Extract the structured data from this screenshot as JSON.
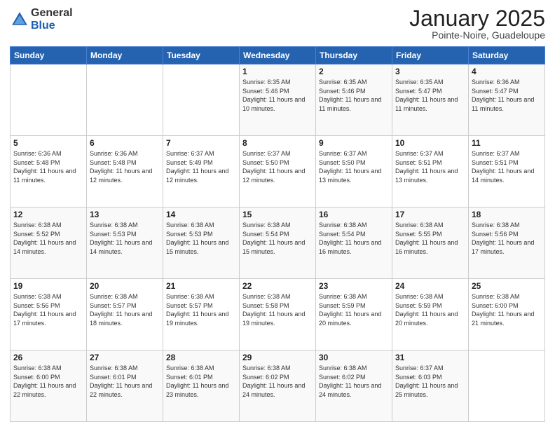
{
  "header": {
    "logo_general": "General",
    "logo_blue": "Blue",
    "month_title": "January 2025",
    "subtitle": "Pointe-Noire, Guadeloupe"
  },
  "weekdays": [
    "Sunday",
    "Monday",
    "Tuesday",
    "Wednesday",
    "Thursday",
    "Friday",
    "Saturday"
  ],
  "weeks": [
    [
      {
        "day": "",
        "sunrise": "",
        "sunset": "",
        "daylight": ""
      },
      {
        "day": "",
        "sunrise": "",
        "sunset": "",
        "daylight": ""
      },
      {
        "day": "",
        "sunrise": "",
        "sunset": "",
        "daylight": ""
      },
      {
        "day": "1",
        "sunrise": "Sunrise: 6:35 AM",
        "sunset": "Sunset: 5:46 PM",
        "daylight": "Daylight: 11 hours and 10 minutes."
      },
      {
        "day": "2",
        "sunrise": "Sunrise: 6:35 AM",
        "sunset": "Sunset: 5:46 PM",
        "daylight": "Daylight: 11 hours and 11 minutes."
      },
      {
        "day": "3",
        "sunrise": "Sunrise: 6:35 AM",
        "sunset": "Sunset: 5:47 PM",
        "daylight": "Daylight: 11 hours and 11 minutes."
      },
      {
        "day": "4",
        "sunrise": "Sunrise: 6:36 AM",
        "sunset": "Sunset: 5:47 PM",
        "daylight": "Daylight: 11 hours and 11 minutes."
      }
    ],
    [
      {
        "day": "5",
        "sunrise": "Sunrise: 6:36 AM",
        "sunset": "Sunset: 5:48 PM",
        "daylight": "Daylight: 11 hours and 11 minutes."
      },
      {
        "day": "6",
        "sunrise": "Sunrise: 6:36 AM",
        "sunset": "Sunset: 5:48 PM",
        "daylight": "Daylight: 11 hours and 12 minutes."
      },
      {
        "day": "7",
        "sunrise": "Sunrise: 6:37 AM",
        "sunset": "Sunset: 5:49 PM",
        "daylight": "Daylight: 11 hours and 12 minutes."
      },
      {
        "day": "8",
        "sunrise": "Sunrise: 6:37 AM",
        "sunset": "Sunset: 5:50 PM",
        "daylight": "Daylight: 11 hours and 12 minutes."
      },
      {
        "day": "9",
        "sunrise": "Sunrise: 6:37 AM",
        "sunset": "Sunset: 5:50 PM",
        "daylight": "Daylight: 11 hours and 13 minutes."
      },
      {
        "day": "10",
        "sunrise": "Sunrise: 6:37 AM",
        "sunset": "Sunset: 5:51 PM",
        "daylight": "Daylight: 11 hours and 13 minutes."
      },
      {
        "day": "11",
        "sunrise": "Sunrise: 6:37 AM",
        "sunset": "Sunset: 5:51 PM",
        "daylight": "Daylight: 11 hours and 14 minutes."
      }
    ],
    [
      {
        "day": "12",
        "sunrise": "Sunrise: 6:38 AM",
        "sunset": "Sunset: 5:52 PM",
        "daylight": "Daylight: 11 hours and 14 minutes."
      },
      {
        "day": "13",
        "sunrise": "Sunrise: 6:38 AM",
        "sunset": "Sunset: 5:53 PM",
        "daylight": "Daylight: 11 hours and 14 minutes."
      },
      {
        "day": "14",
        "sunrise": "Sunrise: 6:38 AM",
        "sunset": "Sunset: 5:53 PM",
        "daylight": "Daylight: 11 hours and 15 minutes."
      },
      {
        "day": "15",
        "sunrise": "Sunrise: 6:38 AM",
        "sunset": "Sunset: 5:54 PM",
        "daylight": "Daylight: 11 hours and 15 minutes."
      },
      {
        "day": "16",
        "sunrise": "Sunrise: 6:38 AM",
        "sunset": "Sunset: 5:54 PM",
        "daylight": "Daylight: 11 hours and 16 minutes."
      },
      {
        "day": "17",
        "sunrise": "Sunrise: 6:38 AM",
        "sunset": "Sunset: 5:55 PM",
        "daylight": "Daylight: 11 hours and 16 minutes."
      },
      {
        "day": "18",
        "sunrise": "Sunrise: 6:38 AM",
        "sunset": "Sunset: 5:56 PM",
        "daylight": "Daylight: 11 hours and 17 minutes."
      }
    ],
    [
      {
        "day": "19",
        "sunrise": "Sunrise: 6:38 AM",
        "sunset": "Sunset: 5:56 PM",
        "daylight": "Daylight: 11 hours and 17 minutes."
      },
      {
        "day": "20",
        "sunrise": "Sunrise: 6:38 AM",
        "sunset": "Sunset: 5:57 PM",
        "daylight": "Daylight: 11 hours and 18 minutes."
      },
      {
        "day": "21",
        "sunrise": "Sunrise: 6:38 AM",
        "sunset": "Sunset: 5:57 PM",
        "daylight": "Daylight: 11 hours and 19 minutes."
      },
      {
        "day": "22",
        "sunrise": "Sunrise: 6:38 AM",
        "sunset": "Sunset: 5:58 PM",
        "daylight": "Daylight: 11 hours and 19 minutes."
      },
      {
        "day": "23",
        "sunrise": "Sunrise: 6:38 AM",
        "sunset": "Sunset: 5:59 PM",
        "daylight": "Daylight: 11 hours and 20 minutes."
      },
      {
        "day": "24",
        "sunrise": "Sunrise: 6:38 AM",
        "sunset": "Sunset: 5:59 PM",
        "daylight": "Daylight: 11 hours and 20 minutes."
      },
      {
        "day": "25",
        "sunrise": "Sunrise: 6:38 AM",
        "sunset": "Sunset: 6:00 PM",
        "daylight": "Daylight: 11 hours and 21 minutes."
      }
    ],
    [
      {
        "day": "26",
        "sunrise": "Sunrise: 6:38 AM",
        "sunset": "Sunset: 6:00 PM",
        "daylight": "Daylight: 11 hours and 22 minutes."
      },
      {
        "day": "27",
        "sunrise": "Sunrise: 6:38 AM",
        "sunset": "Sunset: 6:01 PM",
        "daylight": "Daylight: 11 hours and 22 minutes."
      },
      {
        "day": "28",
        "sunrise": "Sunrise: 6:38 AM",
        "sunset": "Sunset: 6:01 PM",
        "daylight": "Daylight: 11 hours and 23 minutes."
      },
      {
        "day": "29",
        "sunrise": "Sunrise: 6:38 AM",
        "sunset": "Sunset: 6:02 PM",
        "daylight": "Daylight: 11 hours and 24 minutes."
      },
      {
        "day": "30",
        "sunrise": "Sunrise: 6:38 AM",
        "sunset": "Sunset: 6:02 PM",
        "daylight": "Daylight: 11 hours and 24 minutes."
      },
      {
        "day": "31",
        "sunrise": "Sunrise: 6:37 AM",
        "sunset": "Sunset: 6:03 PM",
        "daylight": "Daylight: 11 hours and 25 minutes."
      },
      {
        "day": "",
        "sunrise": "",
        "sunset": "",
        "daylight": ""
      }
    ]
  ]
}
